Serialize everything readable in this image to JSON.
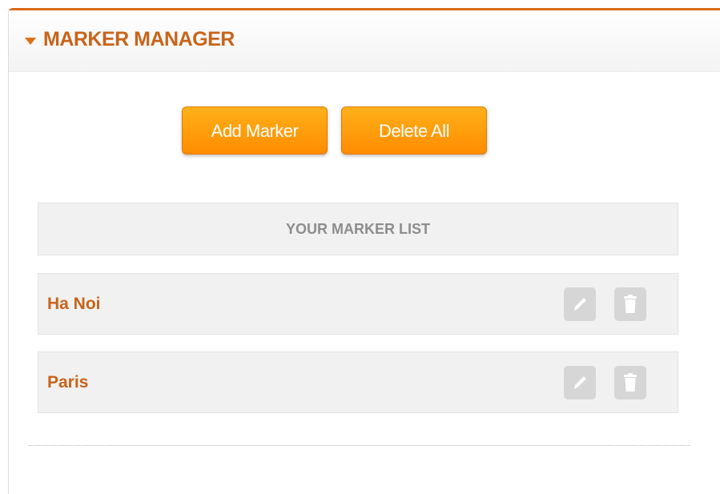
{
  "panel": {
    "title": "MARKER MANAGER",
    "caret_icon": "caret-down-icon",
    "accent_color": "#d96b14"
  },
  "actions": {
    "add_label": "Add Marker",
    "delete_all_label": "Delete All",
    "button_color": "#ff9a0a"
  },
  "marker_list": {
    "header": "YOUR MARKER LIST",
    "items": [
      {
        "name": "Ha Noi",
        "edit_icon": "pencil-icon",
        "delete_icon": "trash-icon"
      },
      {
        "name": "Paris",
        "edit_icon": "pencil-icon",
        "delete_icon": "trash-icon"
      }
    ]
  }
}
